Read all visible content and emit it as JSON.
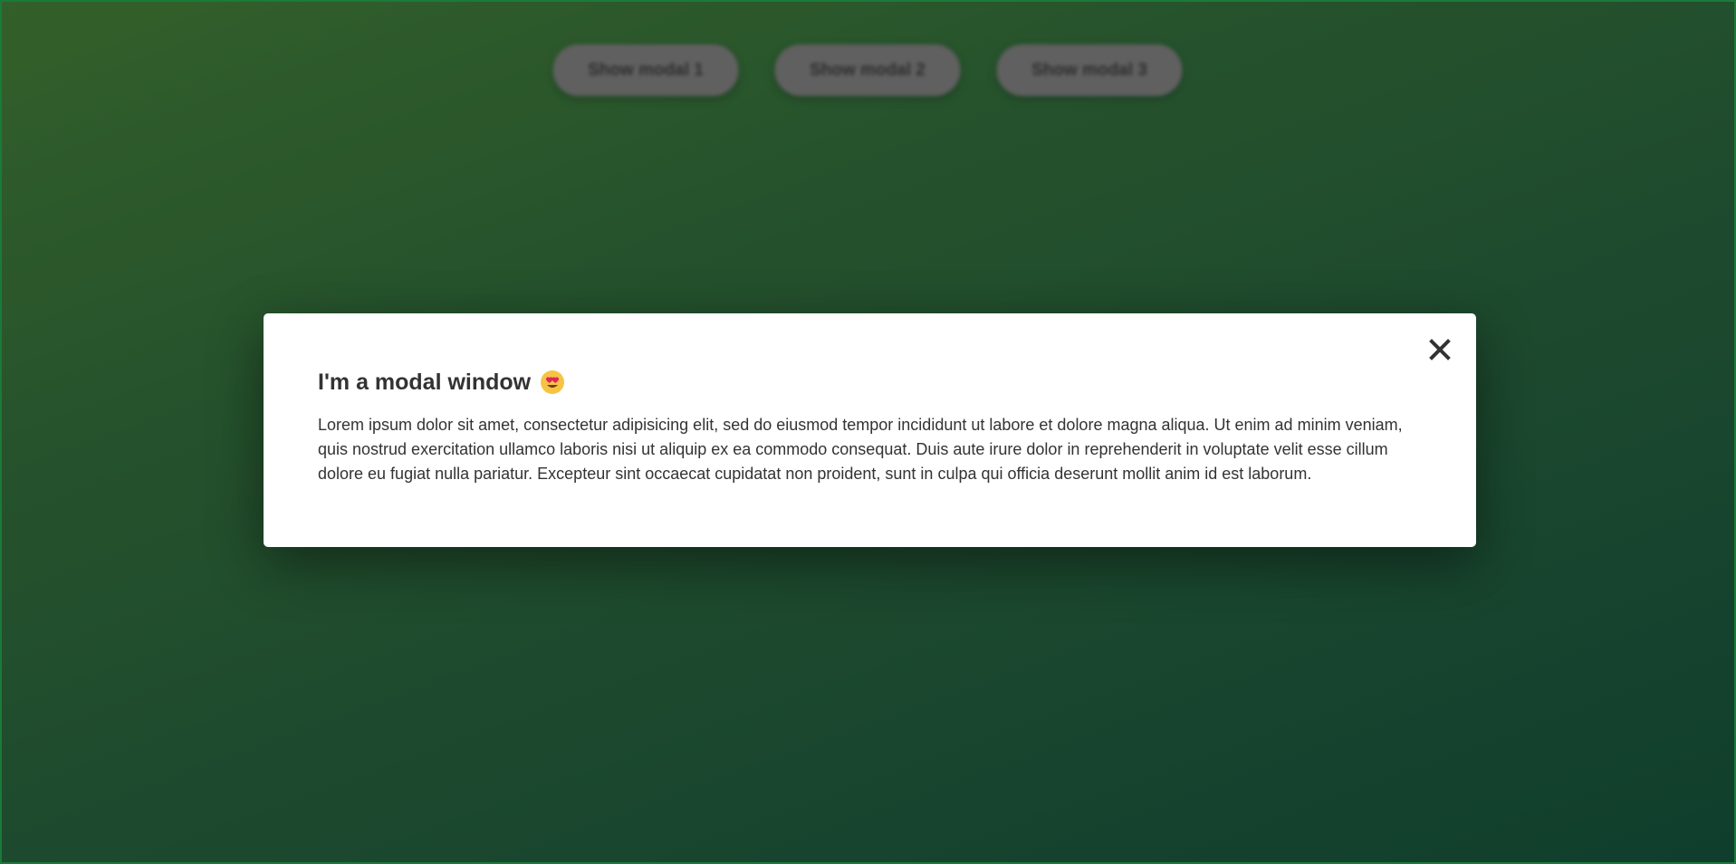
{
  "page": {
    "buttons": [
      {
        "label": "Show modal 1"
      },
      {
        "label": "Show modal 2"
      },
      {
        "label": "Show modal 3"
      }
    ]
  },
  "modal": {
    "title": "I'm a modal window",
    "title_icon": "heart-eyes-emoji-icon",
    "body": "Lorem ipsum dolor sit amet, consectetur adipisicing elit, sed do eiusmod tempor incididunt ut labore et dolore magna aliqua. Ut enim ad minim veniam, quis nostrud exercitation ullamco laboris nisi ut aliquip ex ea commodo consequat. Duis aute irure dolor in reprehenderit in voluptate velit esse cillum dolore eu fugiat nulla pariatur. Excepteur sint occaecat cupidatat non proident, sunt in culpa qui officia deserunt mollit anim id est laborum.",
    "close_icon": "close-icon"
  },
  "colors": {
    "background_top": "#3b6d30",
    "background_bottom": "#124734",
    "button_bg": "#6e6e6e",
    "modal_bg": "#ffffff",
    "text": "#333333"
  }
}
